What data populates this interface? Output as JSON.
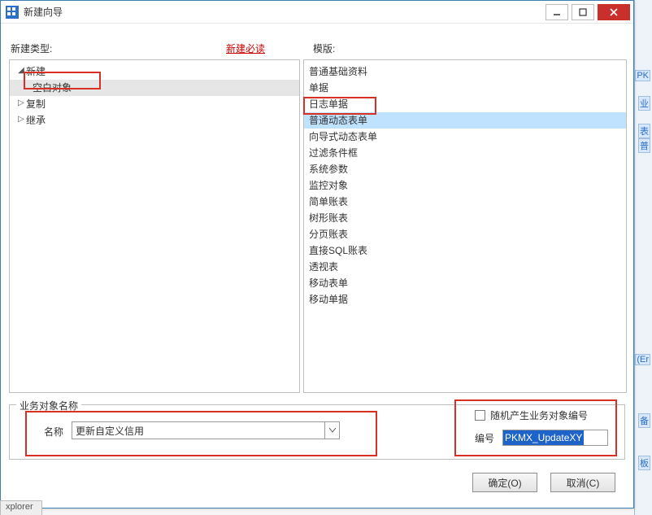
{
  "window": {
    "title": "新建向导",
    "min_tooltip": "最小化",
    "max_tooltip": "最大化",
    "close_tooltip": "关闭"
  },
  "labels": {
    "left_header": "新建类型:",
    "link": "新建必读",
    "right_header": "模版:"
  },
  "tree": {
    "nodes": [
      {
        "label": "新建",
        "expanded": true,
        "children": [
          {
            "label": "空白对象",
            "selected": true
          }
        ]
      },
      {
        "label": "复制",
        "expanded": false
      },
      {
        "label": "继承",
        "expanded": false
      }
    ]
  },
  "templates": {
    "items": [
      "普通基础资料",
      "单据",
      "日志单据",
      "普通动态表单",
      "向导式动态表单",
      "过滤条件框",
      "系统参数",
      "监控对象",
      "简单账表",
      "树形账表",
      "分页账表",
      "直接SQL账表",
      "透视表",
      "移动表单",
      "移动单据"
    ],
    "selected_index": 3
  },
  "bottom": {
    "group_legend": "业务对象名称",
    "name_label": "名称",
    "name_value": "更新自定义信用",
    "random_checkbox_label": "随机产生业务对象编号",
    "random_checked": false,
    "code_label": "编号",
    "code_value": "PKMX_UpdateXY"
  },
  "buttons": {
    "ok": "确定(O)",
    "cancel": "取消(C)"
  },
  "background": {
    "explorer_tab": "xplorer",
    "chips": [
      "PK",
      "业",
      "表",
      "普",
      "板",
      "(Er",
      "备"
    ]
  }
}
